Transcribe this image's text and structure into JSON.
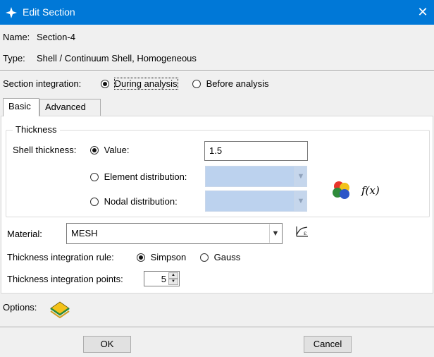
{
  "window": {
    "title": "Edit Section",
    "close_glyph": "✕"
  },
  "name": {
    "label": "Name:",
    "value": "Section-4"
  },
  "type": {
    "label": "Type:",
    "value": "Shell / Continuum Shell, Homogeneous"
  },
  "section_integration": {
    "label": "Section integration:",
    "options": [
      {
        "label": "During analysis",
        "selected": true
      },
      {
        "label": "Before analysis",
        "selected": false
      }
    ]
  },
  "tabs": [
    {
      "label": "Basic",
      "active": true
    },
    {
      "label": "Advanced",
      "active": false
    }
  ],
  "thickness": {
    "group_label": "Thickness",
    "shell_thickness_label": "Shell thickness:",
    "value_option": {
      "label": "Value:",
      "selected": true,
      "value": "1.5"
    },
    "element_distribution": {
      "label": "Element distribution:",
      "selected": false
    },
    "nodal_distribution": {
      "label": "Nodal distribution:",
      "selected": false
    },
    "fx_label": "f(x)"
  },
  "material": {
    "label": "Material:",
    "value": "MESH"
  },
  "integration_rule": {
    "label": "Thickness integration rule:",
    "options": [
      {
        "label": "Simpson",
        "selected": true
      },
      {
        "label": "Gauss",
        "selected": false
      }
    ]
  },
  "integration_points": {
    "label": "Thickness integration points:",
    "value": "5"
  },
  "options": {
    "label": "Options:"
  },
  "buttons": {
    "ok": "OK",
    "cancel": "Cancel"
  },
  "colors": {
    "titlebar": "#0078d7",
    "disabled_field": "#bcd2ee",
    "background": "#f0f0f0"
  }
}
